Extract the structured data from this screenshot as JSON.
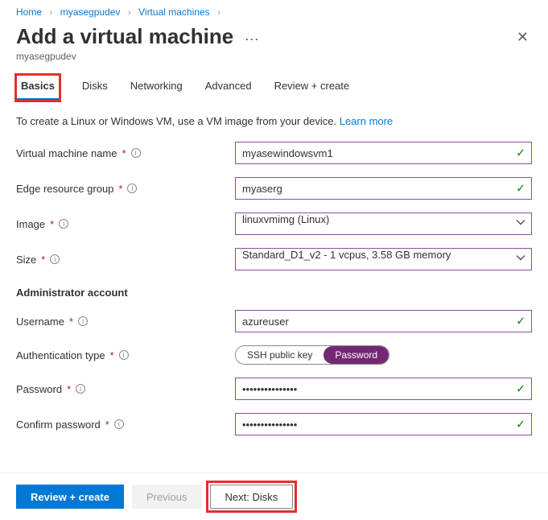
{
  "breadcrumb": {
    "home": "Home",
    "resource": "myasegpudev",
    "section": "Virtual machines"
  },
  "header": {
    "title": "Add a virtual machine",
    "subtitle": "myasegpudev"
  },
  "tabs": {
    "basics": "Basics",
    "disks": "Disks",
    "networking": "Networking",
    "advanced": "Advanced",
    "review": "Review + create"
  },
  "description": {
    "text": "To create a Linux or Windows VM, use a VM image from your device. ",
    "link": "Learn more"
  },
  "labels": {
    "vm_name": "Virtual machine name",
    "erg": "Edge resource group",
    "image": "Image",
    "size": "Size",
    "admin_section": "Administrator account",
    "username": "Username",
    "auth_type": "Authentication type",
    "password": "Password",
    "confirm_password": "Confirm password"
  },
  "values": {
    "vm_name": "myasewindowsvm1",
    "erg": "myaserg",
    "image": "linuxvmimg (Linux)",
    "size": "Standard_D1_v2 - 1 vcpus, 3.58 GB memory",
    "username": "azureuser",
    "password": "•••••••••••••••",
    "confirm_password": "•••••••••••••••"
  },
  "auth_options": {
    "ssh": "SSH public key",
    "pwd": "Password"
  },
  "footer": {
    "review": "Review + create",
    "previous": "Previous",
    "next": "Next: Disks"
  }
}
